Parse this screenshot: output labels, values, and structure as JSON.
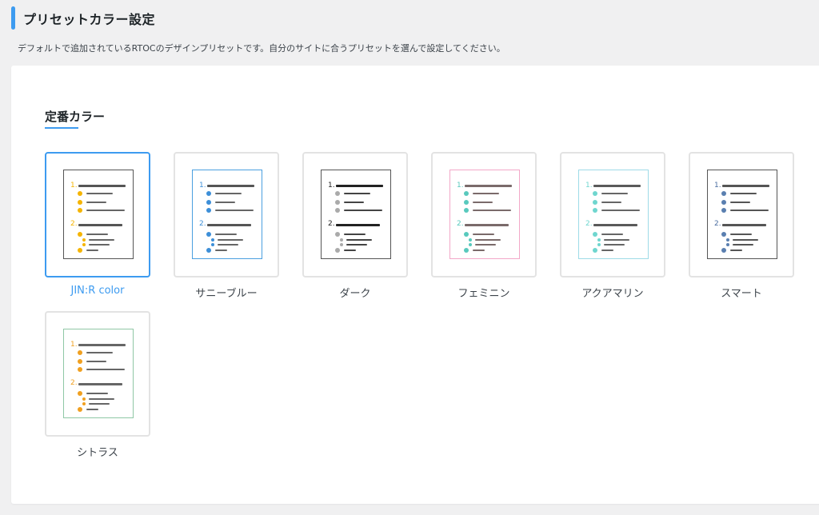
{
  "header": {
    "title": "プリセットカラー設定",
    "description": "デフォルトで追加されているRTOCのデザインプリセットです。自分のサイトに合うプリセットを選んで設定してください。",
    "accent": "#3d9bf0"
  },
  "section": {
    "title": "定番カラー"
  },
  "presets": [
    {
      "label": "JIN:R color",
      "selected": true,
      "colors": {
        "frame": "#555555",
        "num": "#f5b400",
        "heading": "#555555",
        "dot": "#f5b400",
        "sdot": "#f5b400",
        "line": "#666666"
      }
    },
    {
      "label": "サニーブルー",
      "selected": false,
      "colors": {
        "frame": "#4a9fe0",
        "num": "#3d8fd8",
        "heading": "#555555",
        "dot": "#3d8fd8",
        "sdot": "#3d8fd8",
        "line": "#666666"
      }
    },
    {
      "label": "ダーク",
      "selected": false,
      "colors": {
        "frame": "#555555",
        "num": "#222222",
        "heading": "#222222",
        "dot": "#aaaaaa",
        "sdot": "#aaaaaa",
        "line": "#444444"
      }
    },
    {
      "label": "フェミニン",
      "selected": false,
      "colors": {
        "frame": "#f3a8c8",
        "num": "#58c9bd",
        "heading": "#7a6a6a",
        "dot": "#58c9bd",
        "sdot": "#58c9bd",
        "line": "#7a6a6a"
      }
    },
    {
      "label": "アクアマリン",
      "selected": false,
      "colors": {
        "frame": "#9edbe7",
        "num": "#6fd6cf",
        "heading": "#5a5a5a",
        "dot": "#6fd6cf",
        "sdot": "#6fd6cf",
        "line": "#666666"
      }
    },
    {
      "label": "スマート",
      "selected": false,
      "colors": {
        "frame": "#555555",
        "num": "#4a6da0",
        "heading": "#555555",
        "dot": "#5a7fb0",
        "sdot": "#5a7fb0",
        "line": "#555555"
      }
    },
    {
      "label": "シトラス",
      "selected": false,
      "colors": {
        "frame": "#8fc7a5",
        "num": "#f0a020",
        "heading": "#666666",
        "dot": "#f0a020",
        "sdot": "#f0a020",
        "line": "#666666"
      }
    }
  ]
}
